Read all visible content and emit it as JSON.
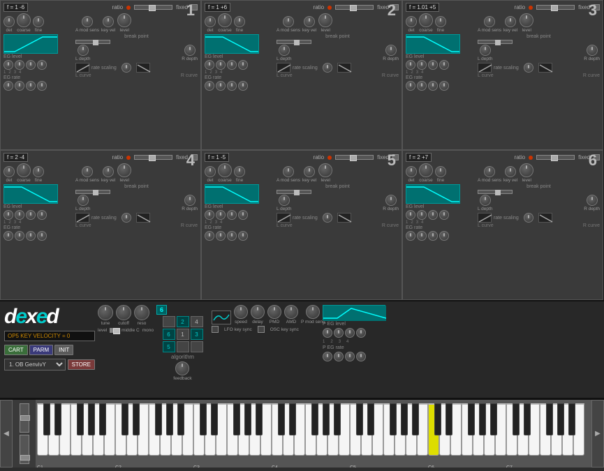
{
  "operators": [
    {
      "id": 1,
      "freq": "f = 1 -6",
      "ratio": "ratio",
      "fixed": "fixed",
      "labels": {
        "det": "det",
        "coarse": "coarse",
        "fine": "fine",
        "a_mod_sens": "A mod sens",
        "key_vel": "key vel",
        "level": "level",
        "eg_level": "EG level",
        "break_point": "break point",
        "l_depth": "L depth",
        "r_depth": "R depth",
        "rate_scaling": "rate scaling",
        "eg_rate": "EG rate",
        "l_curve": "L curve",
        "r_curve": "R curve"
      },
      "eg_shape": "rise",
      "numbers": [
        1,
        2,
        3,
        4
      ]
    },
    {
      "id": 2,
      "freq": "f = 1 +6",
      "ratio": "ratio",
      "fixed": "fixed",
      "eg_shape": "fall",
      "numbers": [
        1,
        2,
        3,
        4
      ]
    },
    {
      "id": 3,
      "freq": "f = 1.01 +5",
      "ratio": "ratio",
      "fixed": "fixed",
      "eg_shape": "fall",
      "numbers": [
        1,
        2,
        3,
        4
      ]
    },
    {
      "id": 4,
      "freq": "f = 2 -4",
      "ratio": "ratio",
      "fixed": "fixed",
      "eg_shape": "fall",
      "numbers": [
        1,
        2,
        3,
        4
      ]
    },
    {
      "id": 5,
      "freq": "f = 1 -5",
      "ratio": "ratio",
      "fixed": "fixed",
      "eg_shape": "fall",
      "numbers": [
        1,
        2,
        3,
        4
      ]
    },
    {
      "id": 6,
      "freq": "f = 2 +7",
      "ratio": "ratio",
      "fixed": "fixed",
      "eg_shape": "fall",
      "numbers": [
        1,
        2,
        3,
        4
      ]
    }
  ],
  "bottom": {
    "logo": "dexed",
    "op5_status": "OP5 KEY VELOCITY = 0",
    "buttons": {
      "cart": "CART",
      "parm": "PARM",
      "init": "INIT",
      "store": "STORE"
    },
    "preset": "1. OB GenvivY",
    "tune_label": "tune",
    "cutoff_label": "cutoff",
    "reso_label": "reso",
    "level_label": "level",
    "middle_c_label": "middle C",
    "mono_label": "mono",
    "algorithm_badge": "6",
    "algorithm_label": "algorithm",
    "feedback_label": "feedback",
    "lfo": {
      "wave_label": "wave",
      "p_mod_sens_label": "P mod sens",
      "speed_label": "speed",
      "delay_label": "delay",
      "pmd_label": "PMD",
      "amd_label": "AMD",
      "lfo_key_sync": "LFO key sync",
      "osc_key_sync": "OSC key sync"
    },
    "peg": {
      "level_label": "P EG level",
      "rate_label": "P EG rate",
      "numbers": [
        1,
        2,
        3,
        4
      ]
    }
  },
  "algo_cells": [
    {
      "label": "",
      "active": false
    },
    {
      "label": "2",
      "active": true
    },
    {
      "label": "4",
      "active": false
    },
    {
      "label": "6",
      "active": true
    },
    {
      "label": "1",
      "active": false
    },
    {
      "label": "3",
      "active": true
    },
    {
      "label": "5",
      "active": true
    },
    {
      "label": "",
      "active": false
    },
    {
      "label": "",
      "active": false
    }
  ],
  "octave_labels": [
    "C1",
    "C2",
    "C3",
    "C4",
    "C5",
    "C6",
    "C7"
  ],
  "colors": {
    "accent": "#00cccc",
    "bg_op": "#3a3a3a",
    "eg_bg": "#007070",
    "led": "#cc3300"
  }
}
